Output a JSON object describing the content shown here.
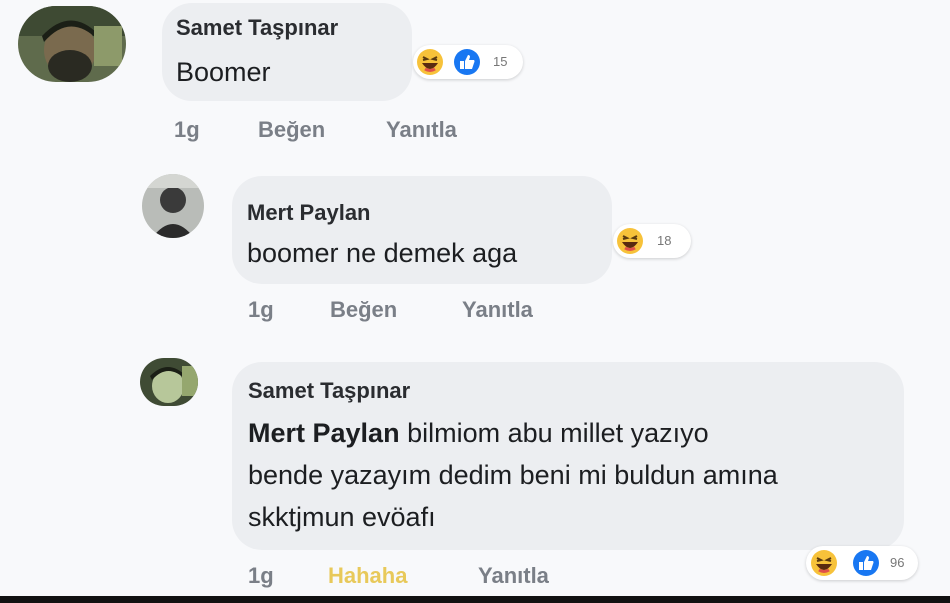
{
  "colors": {
    "bubble": "#eceef1",
    "like_blue": "#1877f2",
    "haha_yellow": "#f7c23a",
    "liked_label": "#e8c95a"
  },
  "comments": [
    {
      "author": "Samet Taşpınar",
      "text": "Boomer",
      "time": "1g",
      "like_label": "Beğen",
      "reply_label": "Yanıtla",
      "reactions": {
        "icons": [
          "haha-icon",
          "like-icon"
        ],
        "count": "15"
      }
    },
    {
      "author": "Mert Paylan",
      "text": "boomer ne demek aga",
      "time": "1g",
      "like_label": "Beğen",
      "reply_label": "Yanıtla",
      "reactions": {
        "icons": [
          "haha-icon"
        ],
        "count": "18"
      }
    },
    {
      "author": "Samet Taşpınar",
      "mention": "Mert Paylan",
      "text_line1": " bilmiom abu millet yazıyo",
      "text_line2": "bende yazayım dedim beni mi buldun amına",
      "text_line3": "skktjmun evöafı",
      "time": "1g",
      "like_label": "Hahaha",
      "reply_label": "Yanıtla",
      "reactions": {
        "icons": [
          "haha-icon",
          "like-icon"
        ],
        "count": "96"
      }
    }
  ]
}
